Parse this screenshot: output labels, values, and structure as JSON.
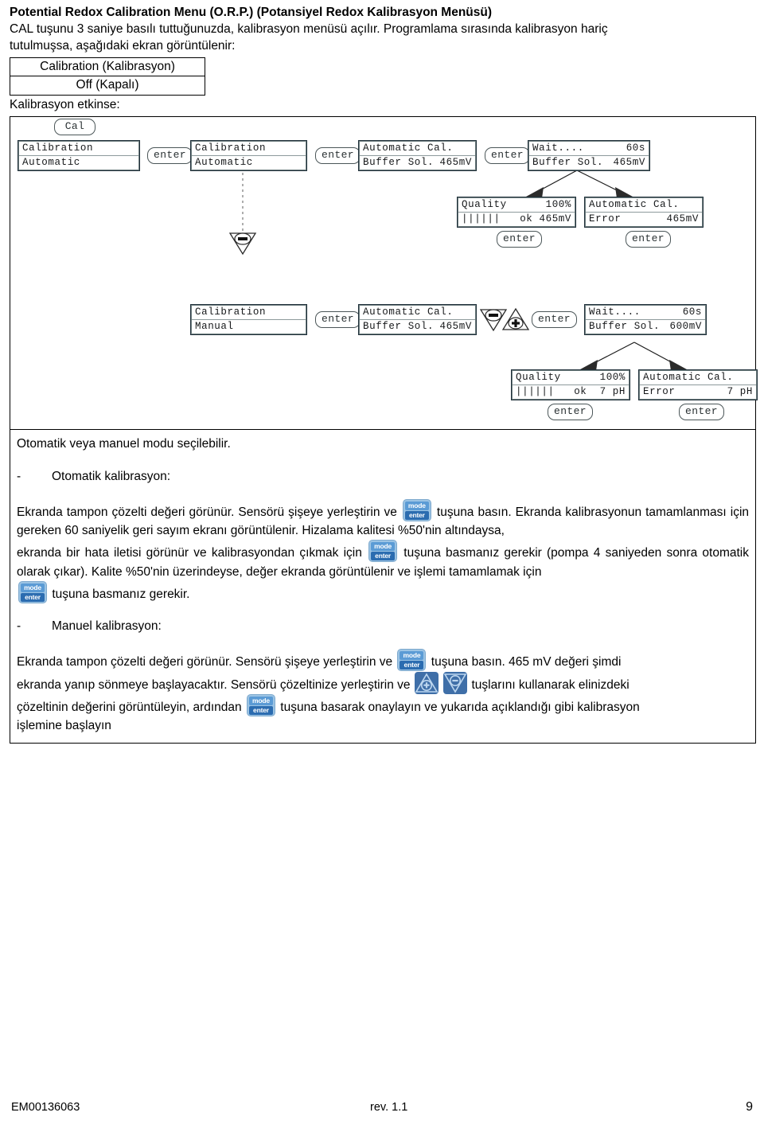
{
  "document": {
    "title": "Potential Redox Calibration Menu (O.R.P.) (Potansiyel Redox Kalibrasyon Menüsü)",
    "intro_line1": "CAL tuşunu 3 saniye basılı tuttuğunuzda, kalibrasyon menüsü açılır. Programlama sırasında kalibrasyon hariç",
    "intro_line2": "tutulmuşsa, aşağıdaki ekran görüntülenir:",
    "menu_box": {
      "row1": "Calibration (Kalibrasyon)",
      "row2": "Off (Kapalı)"
    },
    "sub_line": "Kalibrasyon etkinse:"
  },
  "diagram": {
    "cal_key": "Cal",
    "enter_key": "enter",
    "auto_flow": {
      "screen1": {
        "line1": "Calibration",
        "line2": "Automatic"
      },
      "screen2": {
        "line1": "Calibration",
        "line2": "Automatic"
      },
      "screen3": {
        "line1": "Automatic Cal.",
        "line2_left": "Buffer Sol.",
        "line2_right": "465mV"
      },
      "screen4": {
        "line1_left": "Wait....",
        "line1_right": "60s",
        "line2_left": "Buffer Sol.",
        "line2_right": "465mV"
      },
      "quality": {
        "line1_left": "Quality",
        "line1_right": "100%",
        "line2_left": "||||||",
        "line2_right": "ok 465mV"
      },
      "error": {
        "line1": "Automatic Cal.",
        "line2_left": "Error",
        "line2_right": "465mV"
      }
    },
    "manual_flow": {
      "screen1": {
        "line1": "Calibration",
        "line2": "Manual"
      },
      "screen2": {
        "line1": "Automatic Cal.",
        "line2_left": "Buffer Sol.",
        "line2_right": "465mV"
      },
      "screen3": {
        "line1_left": "Wait....",
        "line1_right": "60s",
        "line2_left": "Buffer Sol.",
        "line2_right": "600mV"
      },
      "quality": {
        "line1_left": "Quality",
        "line1_right": "100%",
        "line2_left": "||||||",
        "line2_right": "ok  7 pH"
      },
      "error": {
        "line1": "Automatic Cal.",
        "line2_left": "Error",
        "line2_right": "7 pH"
      }
    },
    "keycaps": {
      "minus": "−",
      "plus": "+"
    }
  },
  "body": {
    "intro": "Otomatik veya manuel modu seçilebilir.",
    "bullet_auto": {
      "dash": "-",
      "label": "Otomatik kalibrasyon:"
    },
    "auto_p1_a": "Ekranda tampon çözelti değeri görünür. Sensörü şişeye yerleştirin ve",
    "auto_p1_b": "tuşuna basın. Ekranda kalibrasyonun tamamlanması için gereken 60 saniyelik geri sayım ekranı görüntülenir. Hizalama kalitesi %50'nin altındaysa,",
    "auto_p2_a": "ekranda bir hata iletisi görünür ve kalibrasyondan çıkmak için",
    "auto_p2_b": "tuşuna basmanız gerekir (pompa 4 saniyeden sonra otomatik olarak çıkar). Kalite %50'nin üzerindeyse, değer ekranda görüntülenir ve işlemi tamamlamak için",
    "auto_p3": "tuşuna basmanız gerekir.",
    "bullet_manual": {
      "dash": "-",
      "label": "Manuel kalibrasyon:"
    },
    "man_p1_a": "Ekranda tampon çözelti değeri görünür. Sensörü şişeye yerleştirin ve",
    "man_p1_b": "tuşuna basın. 465 mV değeri şimdi",
    "man_p2_a": "ekranda yanıp sönmeye başlayacaktır. Sensörü çözeltinize yerleştirin ve",
    "man_p2_b": "tuşlarını kullanarak elinizdeki",
    "man_p3_a": "çözeltinin değerini görüntüleyin, ardından",
    "man_p3_b": "tuşuna basarak onaylayın ve yukarıda açıklandığı gibi kalibrasyon",
    "man_p4": "işlemine başlayın",
    "keycap": {
      "top": "mode",
      "bottom": "enter"
    }
  },
  "footer": {
    "doc_code": "EM00136063",
    "revision": "rev. 1.1",
    "page": "9"
  },
  "colors": {
    "keycap_top": "#5b9bd5",
    "keycap_bottom": "#2b6cb0",
    "keycap_bg": "#9cc4e4",
    "arrow_key_bg": "#3f6fa8",
    "lcd_border": "#6f7f80",
    "text": "#000000"
  }
}
